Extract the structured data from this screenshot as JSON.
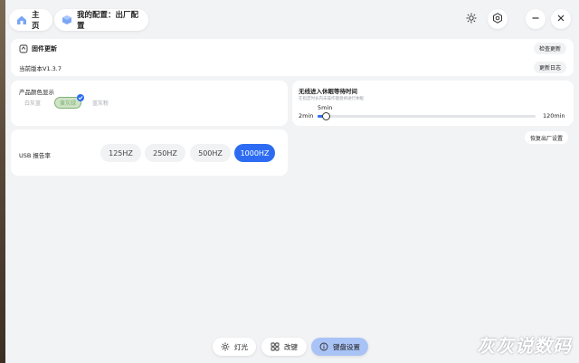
{
  "header": {
    "home_label": "主页",
    "config_label": "我的配置：出厂配置",
    "icons": [
      "home-icon",
      "cube-icon",
      "brightness-icon",
      "settings-icon",
      "minimize-icon",
      "close-icon"
    ]
  },
  "firmware": {
    "title": "固件更新",
    "check_label": "检查更新",
    "version_label": "当前版本V1.3.7",
    "changelog_label": "更新日志"
  },
  "product_color": {
    "title": "产品颜色显示",
    "options": [
      "白灰蓝",
      "黄灰绿",
      "蓝灰粉"
    ],
    "selected_index": 1,
    "accent": "#7fb276"
  },
  "sleep": {
    "title": "无线进入休眠等待时间",
    "description": "在指定时长内未操作键盘将进行休眠",
    "value_label": "5min",
    "min_label": "2min",
    "max_label": "120min",
    "value_fraction": 0.026
  },
  "reset": {
    "label": "恢复出厂设置"
  },
  "usb_rate": {
    "title": "USB 报告率",
    "options": [
      "125HZ",
      "250HZ",
      "500HZ",
      "1000HZ"
    ],
    "selected_index": 3,
    "accent": "#2d6cf2"
  },
  "nav": {
    "items": [
      {
        "label": "灯光",
        "icon": "light-icon"
      },
      {
        "label": "改键",
        "icon": "keymap-icon"
      },
      {
        "label": "键盘设置",
        "icon": "info-icon"
      }
    ],
    "active_index": 2
  },
  "watermark": "灰灰说数码"
}
